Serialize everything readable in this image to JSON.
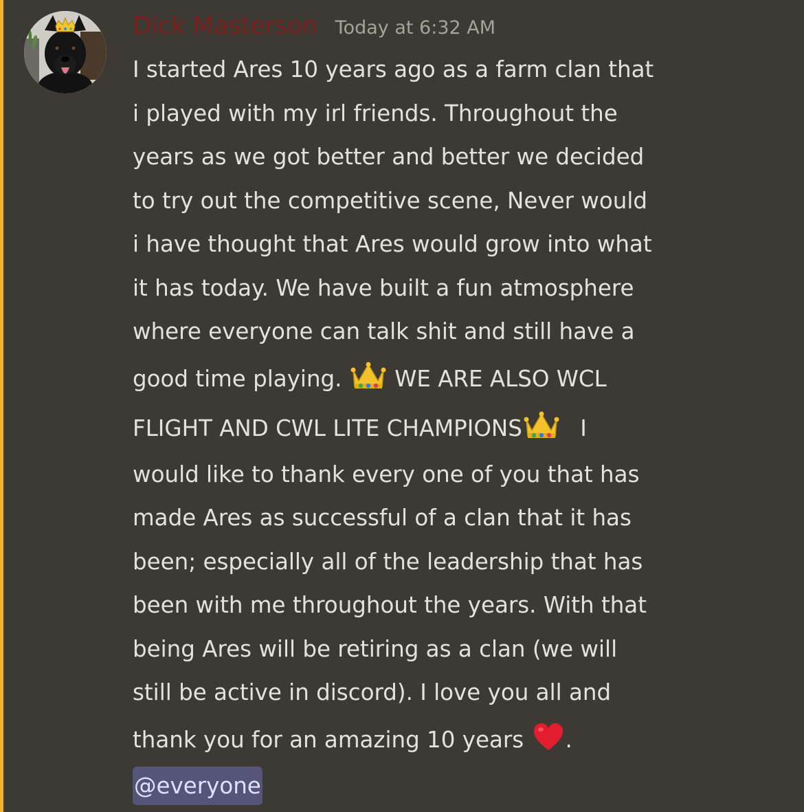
{
  "message": {
    "author": "Dick Masterson",
    "timestamp": "Today at 6:32 AM",
    "lines": [
      "I started Ares 10 years ago as a farm clan that",
      "i played with my irl friends. Throughout the",
      "years as we got better and better we decided",
      "to try out the competitive scene, Never would",
      "i have thought that Ares would grow into what",
      "it has today. We have built a fun atmosphere",
      "where everyone can talk shit and still have a"
    ],
    "line_8_text": "good time playing.",
    "line_8_after": "WE ARE ALSO  WCL",
    "line_9_text": "FLIGHT AND CWL LITE CHAMPIONS",
    "line_9_after": "I",
    "lines_b": [
      "would like to thank every one of you that has",
      "made Ares as successful of a clan that it has",
      "been; especially all of the leadership that has",
      "been with me throughout the years.  With that",
      "being Ares will be retiring as a clan (we will",
      "still be active in discord).  I love you all and"
    ],
    "last_line_text": "thank you for an amazing 10 years",
    "last_line_after": ".",
    "mention": "@everyone",
    "emojis": {
      "crown": "crown-emoji",
      "heart": "red-heart-emoji"
    }
  },
  "colors": {
    "background": "#3c3a33",
    "mention_bar": "#f0b232",
    "username": "#7b1d1d",
    "timestamp": "#a7a39a",
    "text": "#e3e2de",
    "mention_bg": "#55557a"
  }
}
